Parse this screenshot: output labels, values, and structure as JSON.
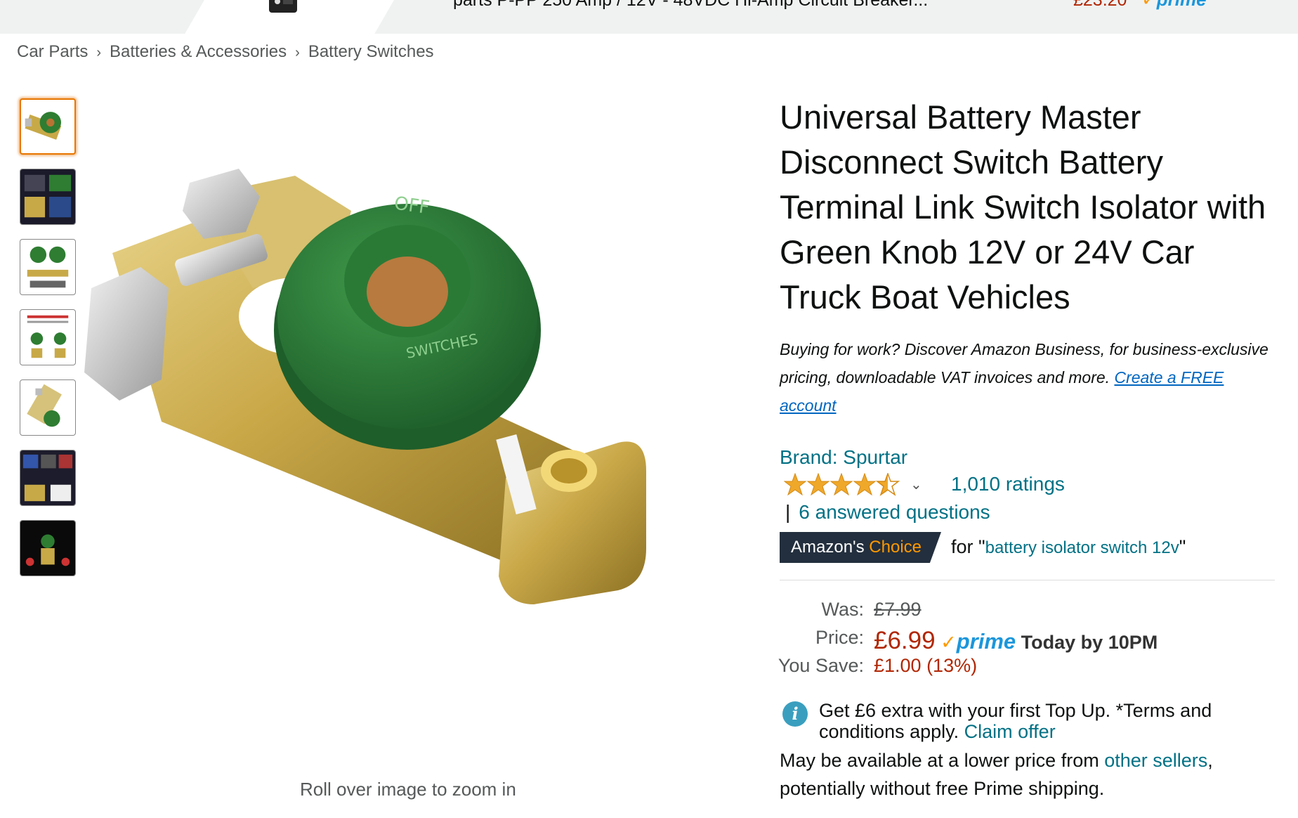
{
  "sponsored": {
    "title": "parts P-PP 250 Amp / 12V - 48VDC Hi-Amp Circuit Breaker...",
    "price": "£23.20",
    "prime_check": "✓",
    "prime_word": "prime"
  },
  "breadcrumb": [
    {
      "label": "Car Parts"
    },
    {
      "label": "Batteries & Accessories"
    },
    {
      "label": "Battery Switches"
    }
  ],
  "breadcrumb_sep": "›",
  "thumbnails_count": 7,
  "zoom_hint": "Roll over image to zoom in",
  "product": {
    "title": "Universal Battery Master Disconnect Switch Battery Terminal Link Switch Isolator with Green Knob 12V or 24V Car Truck Boat Vehicles",
    "business_text": "Buying for work? Discover Amazon Business, for business-exclusive pricing, downloadable VAT invoices and more.",
    "business_link": "Create a FREE account",
    "brand": "Brand: Spurtar",
    "rating_stars": 4.5,
    "ratings_count": "1,010 ratings",
    "qa_pipe": "|",
    "questions": "6 answered questions",
    "badge_prefix": "Amazon's",
    "badge_word": "Choice",
    "choice_for": "for \"",
    "choice_query": "battery isolator switch 12v",
    "choice_close": "\""
  },
  "price": {
    "was_label": "Was:",
    "was_value": "£7.99",
    "price_label": "Price:",
    "price_value": "£6.99",
    "prime_check": "✓",
    "prime_word": "prime",
    "delivery": "Today by 10PM",
    "save_label": "You Save:",
    "save_value": "£1.00 (13%)"
  },
  "offer": {
    "icon": "i",
    "text": "Get £6 extra with your first Top Up. *Terms and conditions apply.",
    "link": "Claim offer"
  },
  "lower_price": {
    "text_before": "May be available at a lower price from",
    "link": "other sellers",
    "text_after": ", potentially without free Prime shipping."
  },
  "colors": {
    "link": "#007185",
    "price": "#B12704",
    "prime": "#1B96DB",
    "badge_bg": "#232f3e",
    "badge_accent": "#ff9900",
    "thumb_active": "#e77600"
  }
}
